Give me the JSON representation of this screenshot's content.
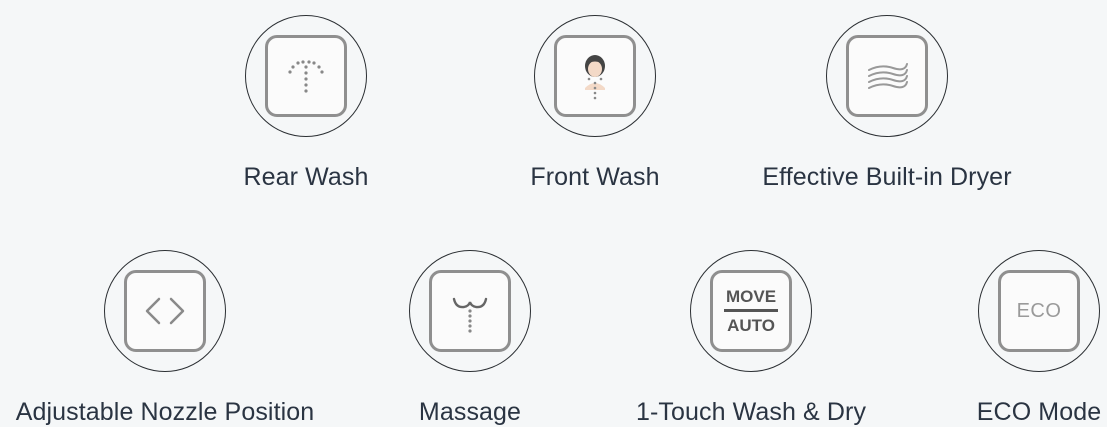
{
  "features_row1": [
    {
      "label": "Rear Wash",
      "icon": "rear-wash-icon"
    },
    {
      "label": "Front Wash",
      "icon": "front-wash-icon"
    },
    {
      "label": "Effective Built-in Dryer",
      "icon": "dryer-icon"
    }
  ],
  "features_row2": [
    {
      "label": "Adjustable Nozzle Position",
      "icon": "nozzle-position-icon"
    },
    {
      "label": "Massage",
      "icon": "massage-icon"
    },
    {
      "label": "1-Touch Wash & Dry",
      "icon": "one-touch-icon",
      "icon_text_top": "MOVE",
      "icon_text_bottom": "AUTO"
    },
    {
      "label": "ECO Mode",
      "icon": "eco-icon",
      "icon_text": "ECO"
    }
  ],
  "colors": {
    "background": "#f5f7f8",
    "circle_border": "#2b2f33",
    "tile_border": "#8f8f8f",
    "label_text": "#2a3442"
  }
}
